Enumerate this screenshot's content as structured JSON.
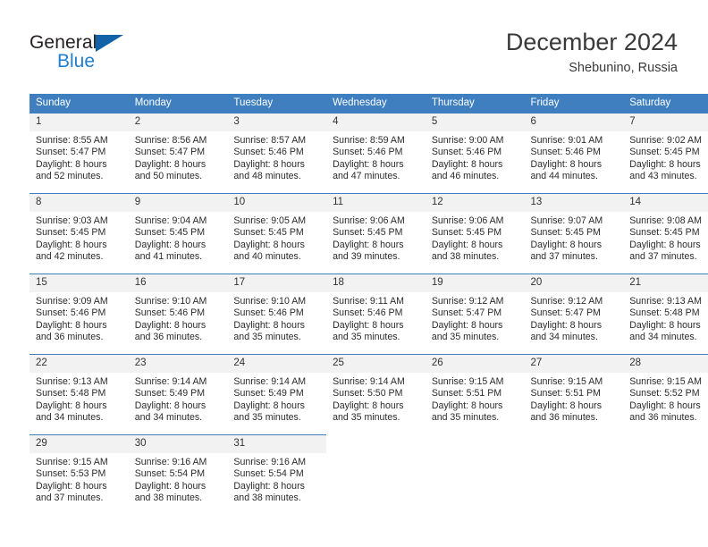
{
  "brand": {
    "name_part1": "General",
    "name_part2": "Blue",
    "triangle_color": "#1162a8",
    "blue_color": "#1f7fd0"
  },
  "header": {
    "title": "December 2024",
    "subtitle": "Shebunino, Russia"
  },
  "theme": {
    "header_blue": "#3f7fbf",
    "daynum_band": "#f2f2f2",
    "text": "#2b2b2b"
  },
  "weekday_headers": [
    "Sunday",
    "Monday",
    "Tuesday",
    "Wednesday",
    "Thursday",
    "Friday",
    "Saturday"
  ],
  "weeks": [
    [
      {
        "day": "1",
        "sunrise": "Sunrise: 8:55 AM",
        "sunset": "Sunset: 5:47 PM",
        "daylight_l1": "Daylight: 8 hours",
        "daylight_l2": "and 52 minutes."
      },
      {
        "day": "2",
        "sunrise": "Sunrise: 8:56 AM",
        "sunset": "Sunset: 5:47 PM",
        "daylight_l1": "Daylight: 8 hours",
        "daylight_l2": "and 50 minutes."
      },
      {
        "day": "3",
        "sunrise": "Sunrise: 8:57 AM",
        "sunset": "Sunset: 5:46 PM",
        "daylight_l1": "Daylight: 8 hours",
        "daylight_l2": "and 48 minutes."
      },
      {
        "day": "4",
        "sunrise": "Sunrise: 8:59 AM",
        "sunset": "Sunset: 5:46 PM",
        "daylight_l1": "Daylight: 8 hours",
        "daylight_l2": "and 47 minutes."
      },
      {
        "day": "5",
        "sunrise": "Sunrise: 9:00 AM",
        "sunset": "Sunset: 5:46 PM",
        "daylight_l1": "Daylight: 8 hours",
        "daylight_l2": "and 46 minutes."
      },
      {
        "day": "6",
        "sunrise": "Sunrise: 9:01 AM",
        "sunset": "Sunset: 5:46 PM",
        "daylight_l1": "Daylight: 8 hours",
        "daylight_l2": "and 44 minutes."
      },
      {
        "day": "7",
        "sunrise": "Sunrise: 9:02 AM",
        "sunset": "Sunset: 5:45 PM",
        "daylight_l1": "Daylight: 8 hours",
        "daylight_l2": "and 43 minutes."
      }
    ],
    [
      {
        "day": "8",
        "sunrise": "Sunrise: 9:03 AM",
        "sunset": "Sunset: 5:45 PM",
        "daylight_l1": "Daylight: 8 hours",
        "daylight_l2": "and 42 minutes."
      },
      {
        "day": "9",
        "sunrise": "Sunrise: 9:04 AM",
        "sunset": "Sunset: 5:45 PM",
        "daylight_l1": "Daylight: 8 hours",
        "daylight_l2": "and 41 minutes."
      },
      {
        "day": "10",
        "sunrise": "Sunrise: 9:05 AM",
        "sunset": "Sunset: 5:45 PM",
        "daylight_l1": "Daylight: 8 hours",
        "daylight_l2": "and 40 minutes."
      },
      {
        "day": "11",
        "sunrise": "Sunrise: 9:06 AM",
        "sunset": "Sunset: 5:45 PM",
        "daylight_l1": "Daylight: 8 hours",
        "daylight_l2": "and 39 minutes."
      },
      {
        "day": "12",
        "sunrise": "Sunrise: 9:06 AM",
        "sunset": "Sunset: 5:45 PM",
        "daylight_l1": "Daylight: 8 hours",
        "daylight_l2": "and 38 minutes."
      },
      {
        "day": "13",
        "sunrise": "Sunrise: 9:07 AM",
        "sunset": "Sunset: 5:45 PM",
        "daylight_l1": "Daylight: 8 hours",
        "daylight_l2": "and 37 minutes."
      },
      {
        "day": "14",
        "sunrise": "Sunrise: 9:08 AM",
        "sunset": "Sunset: 5:45 PM",
        "daylight_l1": "Daylight: 8 hours",
        "daylight_l2": "and 37 minutes."
      }
    ],
    [
      {
        "day": "15",
        "sunrise": "Sunrise: 9:09 AM",
        "sunset": "Sunset: 5:46 PM",
        "daylight_l1": "Daylight: 8 hours",
        "daylight_l2": "and 36 minutes."
      },
      {
        "day": "16",
        "sunrise": "Sunrise: 9:10 AM",
        "sunset": "Sunset: 5:46 PM",
        "daylight_l1": "Daylight: 8 hours",
        "daylight_l2": "and 36 minutes."
      },
      {
        "day": "17",
        "sunrise": "Sunrise: 9:10 AM",
        "sunset": "Sunset: 5:46 PM",
        "daylight_l1": "Daylight: 8 hours",
        "daylight_l2": "and 35 minutes."
      },
      {
        "day": "18",
        "sunrise": "Sunrise: 9:11 AM",
        "sunset": "Sunset: 5:46 PM",
        "daylight_l1": "Daylight: 8 hours",
        "daylight_l2": "and 35 minutes."
      },
      {
        "day": "19",
        "sunrise": "Sunrise: 9:12 AM",
        "sunset": "Sunset: 5:47 PM",
        "daylight_l1": "Daylight: 8 hours",
        "daylight_l2": "and 35 minutes."
      },
      {
        "day": "20",
        "sunrise": "Sunrise: 9:12 AM",
        "sunset": "Sunset: 5:47 PM",
        "daylight_l1": "Daylight: 8 hours",
        "daylight_l2": "and 34 minutes."
      },
      {
        "day": "21",
        "sunrise": "Sunrise: 9:13 AM",
        "sunset": "Sunset: 5:48 PM",
        "daylight_l1": "Daylight: 8 hours",
        "daylight_l2": "and 34 minutes."
      }
    ],
    [
      {
        "day": "22",
        "sunrise": "Sunrise: 9:13 AM",
        "sunset": "Sunset: 5:48 PM",
        "daylight_l1": "Daylight: 8 hours",
        "daylight_l2": "and 34 minutes."
      },
      {
        "day": "23",
        "sunrise": "Sunrise: 9:14 AM",
        "sunset": "Sunset: 5:49 PM",
        "daylight_l1": "Daylight: 8 hours",
        "daylight_l2": "and 34 minutes."
      },
      {
        "day": "24",
        "sunrise": "Sunrise: 9:14 AM",
        "sunset": "Sunset: 5:49 PM",
        "daylight_l1": "Daylight: 8 hours",
        "daylight_l2": "and 35 minutes."
      },
      {
        "day": "25",
        "sunrise": "Sunrise: 9:14 AM",
        "sunset": "Sunset: 5:50 PM",
        "daylight_l1": "Daylight: 8 hours",
        "daylight_l2": "and 35 minutes."
      },
      {
        "day": "26",
        "sunrise": "Sunrise: 9:15 AM",
        "sunset": "Sunset: 5:51 PM",
        "daylight_l1": "Daylight: 8 hours",
        "daylight_l2": "and 35 minutes."
      },
      {
        "day": "27",
        "sunrise": "Sunrise: 9:15 AM",
        "sunset": "Sunset: 5:51 PM",
        "daylight_l1": "Daylight: 8 hours",
        "daylight_l2": "and 36 minutes."
      },
      {
        "day": "28",
        "sunrise": "Sunrise: 9:15 AM",
        "sunset": "Sunset: 5:52 PM",
        "daylight_l1": "Daylight: 8 hours",
        "daylight_l2": "and 36 minutes."
      }
    ],
    [
      {
        "day": "29",
        "sunrise": "Sunrise: 9:15 AM",
        "sunset": "Sunset: 5:53 PM",
        "daylight_l1": "Daylight: 8 hours",
        "daylight_l2": "and 37 minutes."
      },
      {
        "day": "30",
        "sunrise": "Sunrise: 9:16 AM",
        "sunset": "Sunset: 5:54 PM",
        "daylight_l1": "Daylight: 8 hours",
        "daylight_l2": "and 38 minutes."
      },
      {
        "day": "31",
        "sunrise": "Sunrise: 9:16 AM",
        "sunset": "Sunset: 5:54 PM",
        "daylight_l1": "Daylight: 8 hours",
        "daylight_l2": "and 38 minutes."
      },
      {
        "day": "",
        "sunrise": "",
        "sunset": "",
        "daylight_l1": "",
        "daylight_l2": ""
      },
      {
        "day": "",
        "sunrise": "",
        "sunset": "",
        "daylight_l1": "",
        "daylight_l2": ""
      },
      {
        "day": "",
        "sunrise": "",
        "sunset": "",
        "daylight_l1": "",
        "daylight_l2": ""
      },
      {
        "day": "",
        "sunrise": "",
        "sunset": "",
        "daylight_l1": "",
        "daylight_l2": ""
      }
    ]
  ]
}
